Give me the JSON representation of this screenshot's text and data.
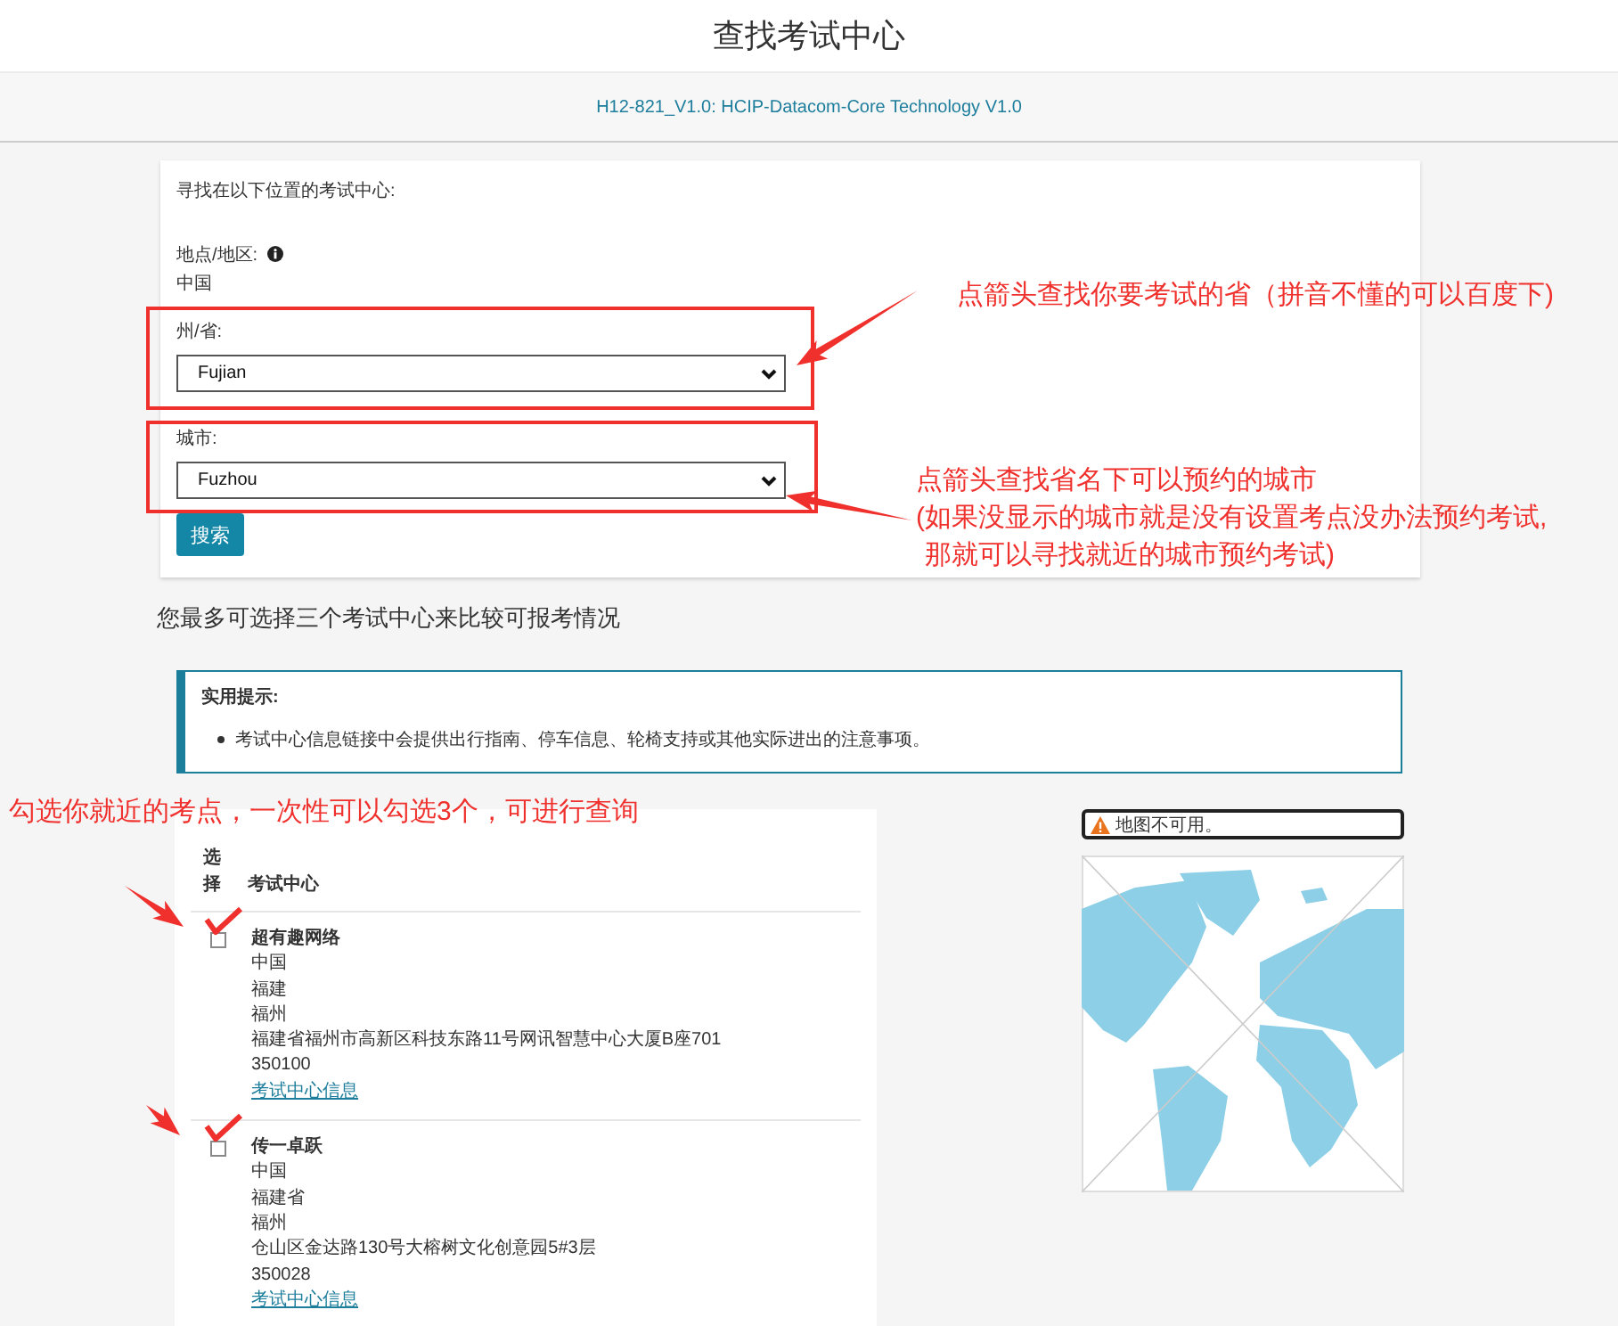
{
  "page": {
    "title": "查找考试中心",
    "exam_link": "H12-821_V1.0: HCIP-Datacom-Core Technology V1.0"
  },
  "search_form": {
    "intro": "寻找在以下位置的考试中心:",
    "location_label": "地点/地区:",
    "location_value": "中国",
    "fields": [
      {
        "label": "州/省:",
        "value": "Fujian"
      },
      {
        "label": "城市:",
        "value": "Fuzhou"
      }
    ],
    "search_button": "搜索"
  },
  "compare_note": "您最多可选择三个考试中心来比较可报考情况",
  "tip": {
    "title": "实用提示:",
    "items": [
      "考试中心信息链接中会提供出行指南、停车信息、轮椅支持或其他实际进出的注意事项。"
    ]
  },
  "results": {
    "columns": [
      "选择",
      "考试中心"
    ],
    "rows": [
      {
        "checked": false,
        "name": "超有趣网络",
        "lines": [
          "中国",
          "福建",
          "福州",
          "福建省福州市高新区科技东路11号网讯智慧中心大厦B座701",
          "350100"
        ],
        "link": "考试中心信息"
      },
      {
        "checked": false,
        "name": "传一卓跃",
        "lines": [
          "中国",
          "福建省",
          "福州",
          "仓山区金达路130号大榕树文化创意园5#3层",
          "350028"
        ],
        "link": "考试中心信息"
      }
    ]
  },
  "map": {
    "notice": "地图不可用。"
  },
  "annotations": [
    {
      "kind": "callout",
      "lines": [
        "点箭头查找你要考试的省（拼音不懂的可以百度下)"
      ]
    },
    {
      "kind": "callout",
      "lines": [
        "点箭头查找省名下可以预约的城市",
        "(如果没显示的城市就是没有设置考点没办法预约考试,",
        "那就可以寻找就近的城市预约考试)"
      ]
    },
    {
      "kind": "callout",
      "lines": [
        "勾选你就近的考点，一次性可以勾选3个，可进行查询"
      ]
    }
  ]
}
